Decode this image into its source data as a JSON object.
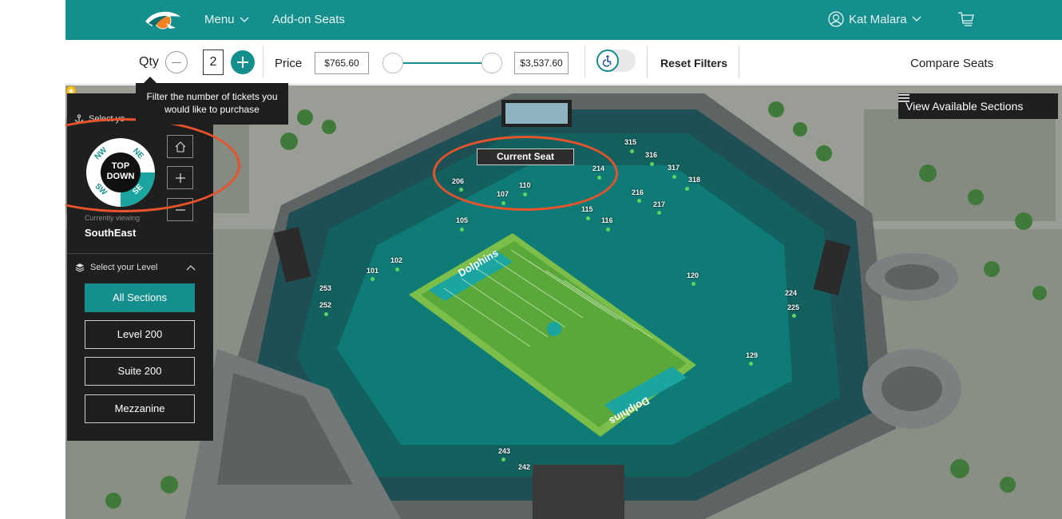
{
  "nav": {
    "menu_label": "Menu",
    "addon_label": "Add-on Seats",
    "user_name": "Kat Malara",
    "colors": {
      "bar": "#148f8d"
    }
  },
  "filters": {
    "qty_label": "Qty",
    "qty_value": "2",
    "price_label": "Price",
    "price_min": "$765.60",
    "price_max": "$3,537.60",
    "reset_label": "Reset Filters",
    "compare_label": "Compare Seats",
    "accessible_icon": "wheelchair-icon"
  },
  "tooltip": {
    "text": "Filter the number of tickets you would like to purchase"
  },
  "map": {
    "view_sections_label": "View Available Sections",
    "current_seat_label": "Current Seat",
    "sections": [
      "315",
      "316",
      "317",
      "318",
      "214",
      "216",
      "217",
      "206",
      "110",
      "107",
      "115",
      "116",
      "105",
      "102",
      "101",
      "120",
      "253",
      "252",
      "224",
      "225",
      "129",
      "243",
      "242"
    ],
    "field_text": "Dolphins"
  },
  "panel": {
    "select_view_label": "Select yo",
    "compass": {
      "nw": "NW",
      "ne": "NE",
      "sw": "SW",
      "se": "SE",
      "center_line1": "TOP",
      "center_line2": "DOWN"
    },
    "currently_viewing_label": "Currently viewing",
    "currently_viewing_value": "SouthEast",
    "level_title": "Select your Level",
    "levels": [
      "All Sections",
      "Level 200",
      "Suite 200",
      "Mezzanine"
    ],
    "active_level": "All Sections"
  }
}
